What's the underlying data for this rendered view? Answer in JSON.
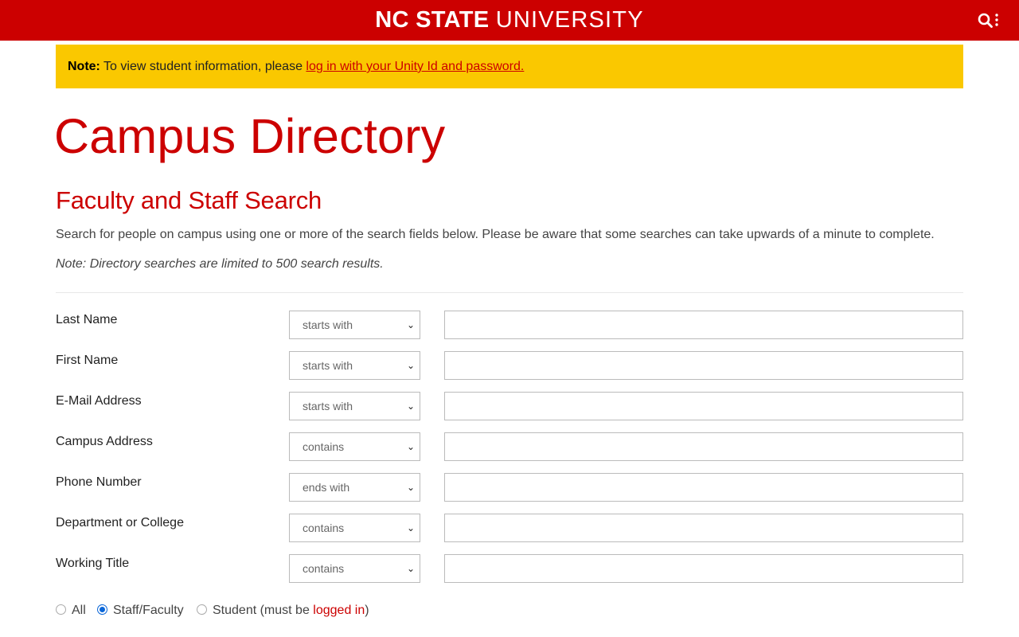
{
  "header": {
    "brand_bold": "NC STATE",
    "brand_light": "UNIVERSITY",
    "search_menu_icon": "search-menu-icon",
    "bg_color": "#cc0000"
  },
  "notice": {
    "label": "Note:",
    "text": "To view student information, please",
    "link": "log in with your Unity Id and password.",
    "bg_color": "#fac800"
  },
  "page": {
    "title": "Campus Directory",
    "section_title": "Faculty and Staff Search",
    "intro": "Search for people on campus using one or more of the search fields below. Please be aware that some searches can take upwards of a minute to complete.",
    "limit_note": "Note: Directory searches are limited to 500 search results."
  },
  "fields": [
    {
      "label": "Last Name",
      "match": "starts with",
      "value": ""
    },
    {
      "label": "First Name",
      "match": "starts with",
      "value": ""
    },
    {
      "label": "E-Mail Address",
      "match": "starts with",
      "value": ""
    },
    {
      "label": "Campus Address",
      "match": "contains",
      "value": ""
    },
    {
      "label": "Phone Number",
      "match": "ends with",
      "value": ""
    },
    {
      "label": "Department or College",
      "match": "contains",
      "value": ""
    },
    {
      "label": "Working Title",
      "match": "contains",
      "value": ""
    }
  ],
  "scope": {
    "options": [
      "All",
      "Staff/Faculty",
      "Student (must be "
    ],
    "selected": "Staff/Faculty",
    "student_link": "logged in",
    "student_suffix": ")"
  }
}
